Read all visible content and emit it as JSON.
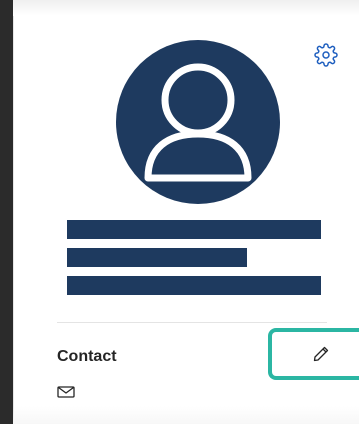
{
  "profile": {
    "contact_label": "Contact"
  },
  "icons": {
    "settings": "gear-icon",
    "edit": "pencil-icon",
    "email": "envelope-icon",
    "avatar": "person-icon"
  },
  "colors": {
    "avatar": "#1e3a5f",
    "redaction": "#1e3a5f",
    "highlight": "#2bb6a3",
    "background": "#2b2b2b"
  }
}
